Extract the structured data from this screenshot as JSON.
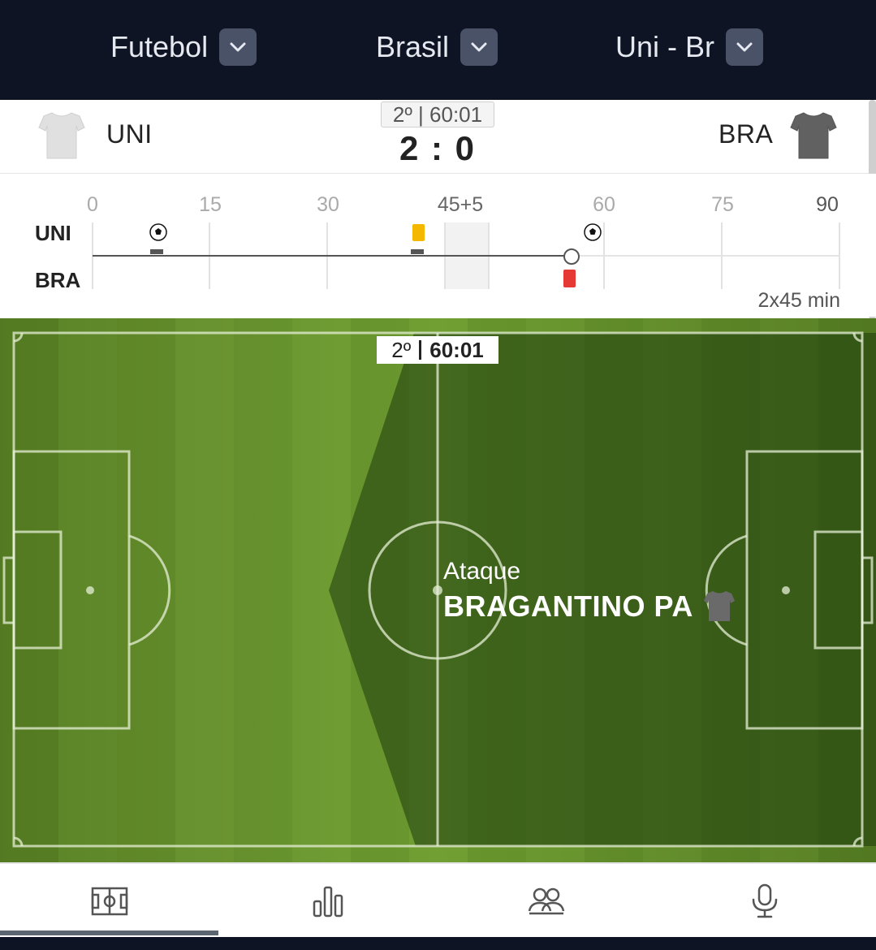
{
  "nav": {
    "sport": "Futebol",
    "country": "Brasil",
    "match": "Uni - Br"
  },
  "header": {
    "home_team": "UNI",
    "away_team": "BRA",
    "clock": "2º | 60:01",
    "score": "2 : 0",
    "colors": {
      "home_shirt": "#e0e0e0",
      "away_shirt": "#616161"
    }
  },
  "timeline": {
    "home_label": "UNI",
    "away_label": "BRA",
    "ticks": [
      "0",
      "15",
      "30",
      "45+5",
      "60",
      "75",
      "90"
    ],
    "format": "2x45 min",
    "progress_minute": 60,
    "events": [
      {
        "team": "home",
        "type": "goal",
        "minute": 8
      },
      {
        "team": "home",
        "type": "yellow-card",
        "minute": 41
      },
      {
        "team": "home",
        "type": "goal",
        "minute": 62
      },
      {
        "team": "away",
        "type": "red-card",
        "minute": 59
      }
    ],
    "colors": {
      "yellow_card": "#f5b800",
      "red_card": "#e53935"
    }
  },
  "pitch": {
    "period": "2º",
    "clock": "60:01",
    "attack_label": "Ataque",
    "attack_team": "BRAGANTINO PA",
    "colors": {
      "grass_light": "#6a9a2a",
      "grass_dark": "#3f6b1a"
    }
  },
  "tabs": [
    {
      "name": "pitch",
      "icon": "pitch-icon"
    },
    {
      "name": "statistics",
      "icon": "bar-chart-icon"
    },
    {
      "name": "lineups",
      "icon": "players-icon"
    },
    {
      "name": "commentary",
      "icon": "microphone-icon"
    }
  ]
}
